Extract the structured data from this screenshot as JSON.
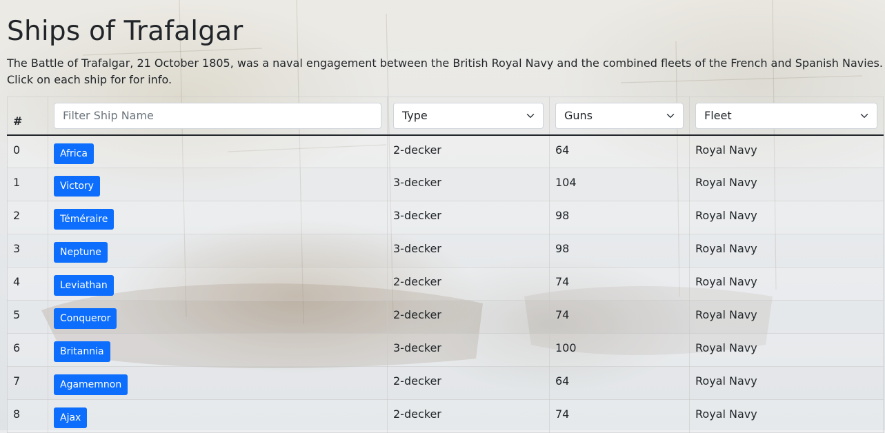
{
  "header": {
    "title": "Ships of Trafalgar",
    "intro": "The Battle of Trafalgar, 21 October 1805, was a naval engagement between the British Royal Navy and the combined fleets of the French and Spanish Navies. Click on each ship for for info."
  },
  "table": {
    "col_num": "#",
    "filter_placeholder": "Filter Ship Name",
    "type_select": "Type",
    "guns_select": "Guns",
    "fleet_select": "Fleet",
    "rows": [
      {
        "num": "0",
        "name": "Africa",
        "type": "2-decker",
        "guns": "64",
        "fleet": "Royal Navy"
      },
      {
        "num": "1",
        "name": "Victory",
        "type": "3-decker",
        "guns": "104",
        "fleet": "Royal Navy"
      },
      {
        "num": "2",
        "name": "Téméraire",
        "type": "3-decker",
        "guns": "98",
        "fleet": "Royal Navy"
      },
      {
        "num": "3",
        "name": "Neptune",
        "type": "3-decker",
        "guns": "98",
        "fleet": "Royal Navy"
      },
      {
        "num": "4",
        "name": "Leviathan",
        "type": "2-decker",
        "guns": "74",
        "fleet": "Royal Navy"
      },
      {
        "num": "5",
        "name": "Conqueror",
        "type": "2-decker",
        "guns": "74",
        "fleet": "Royal Navy"
      },
      {
        "num": "6",
        "name": "Britannia",
        "type": "3-decker",
        "guns": "100",
        "fleet": "Royal Navy"
      },
      {
        "num": "7",
        "name": "Agamemnon",
        "type": "2-decker",
        "guns": "64",
        "fleet": "Royal Navy"
      },
      {
        "num": "8",
        "name": "Ajax",
        "type": "2-decker",
        "guns": "74",
        "fleet": "Royal Navy"
      }
    ]
  },
  "colors": {
    "button": "#0d6efd",
    "text": "#212529"
  },
  "icons": {
    "select_caret": "chevron-down-icon"
  }
}
